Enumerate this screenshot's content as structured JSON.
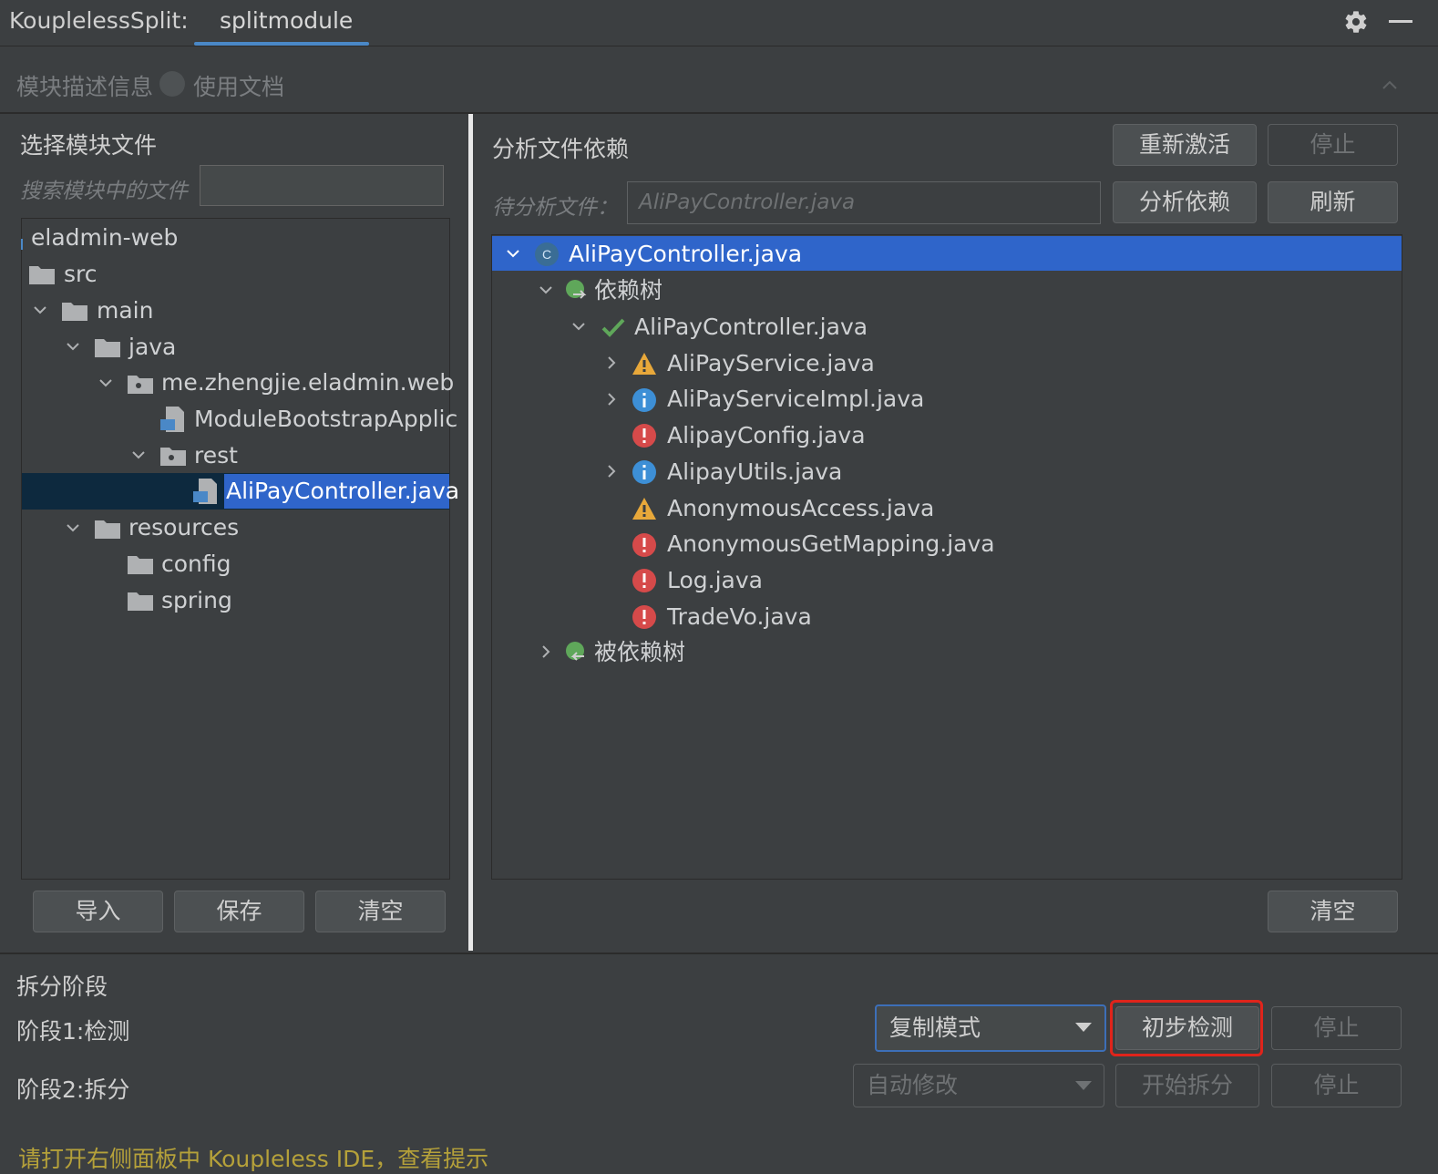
{
  "header": {
    "app_title": "KouplelessSplit:",
    "active_tab": "splitmodule"
  },
  "description_bar": {
    "label": "模块描述信息",
    "doc_link": "使用文档"
  },
  "left_panel": {
    "title": "选择模块文件",
    "search_label": "搜索模块中的文件",
    "search_value": "",
    "tree": [
      {
        "label": "eladmin-web",
        "icon": "module-icon"
      },
      {
        "label": "src",
        "icon": "folder-icon"
      },
      {
        "label": "main",
        "icon": "folder-icon",
        "expanded": true
      },
      {
        "label": "java",
        "icon": "folder-icon",
        "expanded": true
      },
      {
        "label": "me.zhengjie.eladmin.web",
        "icon": "package-icon",
        "expanded": true
      },
      {
        "label": "ModuleBootstrapApplic",
        "icon": "java-file-icon"
      },
      {
        "label": "rest",
        "icon": "package-icon",
        "expanded": true
      },
      {
        "label": "AliPayController.java",
        "icon": "java-file-icon",
        "selected": true
      },
      {
        "label": "resources",
        "icon": "folder-icon",
        "expanded": true
      },
      {
        "label": "config",
        "icon": "folder-icon"
      },
      {
        "label": "spring",
        "icon": "folder-icon"
      }
    ],
    "buttons": {
      "import": "导入",
      "save": "保存",
      "clear": "清空"
    }
  },
  "right_panel": {
    "title": "分析文件依赖",
    "reactivate": "重新激活",
    "stop": "停止",
    "pending_label": "待分析文件：",
    "pending_value": "AliPayController.java",
    "analyze": "分析依赖",
    "refresh": "刷新",
    "clear": "清空",
    "tree": [
      {
        "label": "AliPayController.java",
        "icon": "class-icon",
        "selected": true
      },
      {
        "label": "依赖树",
        "icon": "dependency-tree-icon"
      },
      {
        "label": "AliPayController.java",
        "icon": "check-icon"
      },
      {
        "label": "AliPayService.java",
        "icon": "warning-icon"
      },
      {
        "label": "AliPayServiceImpl.java",
        "icon": "info-icon"
      },
      {
        "label": "AlipayConfig.java",
        "icon": "error-icon"
      },
      {
        "label": "AlipayUtils.java",
        "icon": "info-icon"
      },
      {
        "label": "AnonymousAccess.java",
        "icon": "warning-icon"
      },
      {
        "label": "AnonymousGetMapping.java",
        "icon": "error-icon"
      },
      {
        "label": "Log.java",
        "icon": "error-icon"
      },
      {
        "label": "TradeVo.java",
        "icon": "error-icon"
      },
      {
        "label": "被依赖树",
        "icon": "dependency-tree-icon"
      }
    ]
  },
  "split_stage": {
    "title": "拆分阶段",
    "stage1_label": "阶段1:检测",
    "stage1_mode": "复制模式",
    "stage1_check": "初步检测",
    "stage1_stop": "停止",
    "stage2_label": "阶段2:拆分",
    "stage2_mode": "自动修改",
    "stage2_start": "开始拆分",
    "stage2_stop": "停止"
  },
  "footer": {
    "hint": "请打开右侧面板中 Koupleless IDE，查看提示"
  },
  "colors": {
    "selection": "#2f65ca",
    "warning": "#e8a83a",
    "info": "#3d8fd6",
    "error": "#d64a4a",
    "success": "#5fa75a",
    "highlight_border": "#e0241b"
  }
}
